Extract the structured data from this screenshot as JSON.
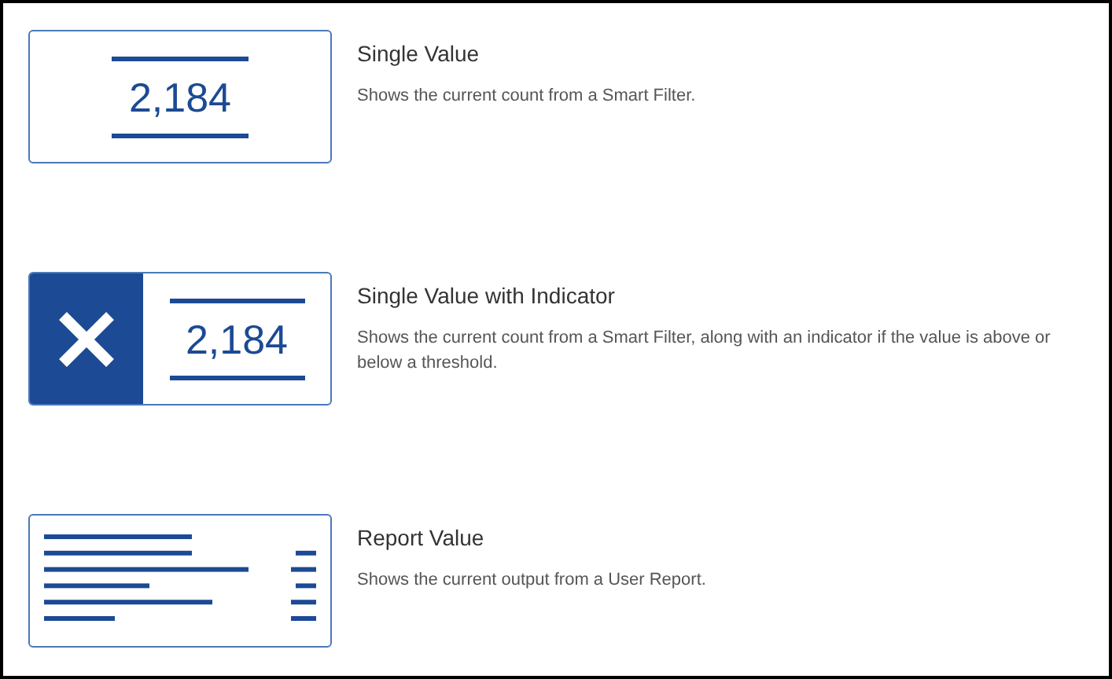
{
  "widgets": [
    {
      "kind": "single",
      "preview_value": "2,184",
      "title": "Single Value",
      "description": "Shows the current count from a Smart Filter."
    },
    {
      "kind": "indicator",
      "preview_value": "2,184",
      "title": "Single Value with Indicator",
      "description": "Shows the current count from a Smart Filter, along with an indicator if the value is above or below a threshold."
    },
    {
      "kind": "report",
      "title": "Report Value",
      "description": "Shows the current output from a User Report."
    }
  ]
}
